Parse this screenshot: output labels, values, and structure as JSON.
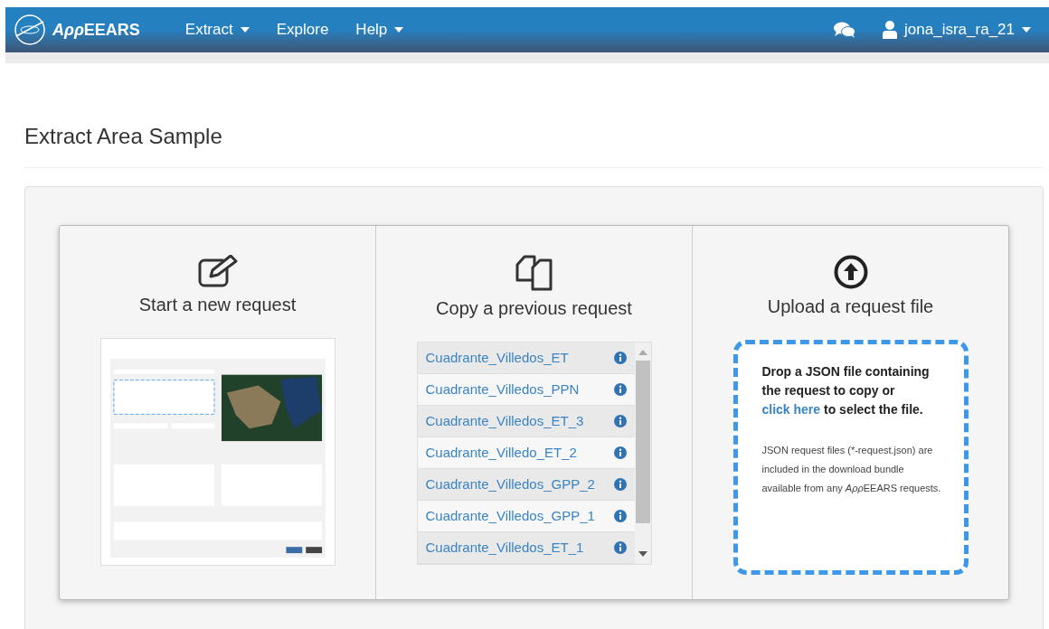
{
  "navbar": {
    "brand": [
      {
        "text": "Aρρ",
        "italic": true
      },
      {
        "text": "EEARS",
        "italic": false
      }
    ],
    "menu": [
      {
        "label": "Extract",
        "dropdown": true
      },
      {
        "label": "Explore",
        "dropdown": false
      },
      {
        "label": "Help",
        "dropdown": true
      }
    ],
    "user": "jona_isra_ra_21"
  },
  "page_title": "Extract Area Sample",
  "options": [
    {
      "kind": "new",
      "title": "Start a new request"
    },
    {
      "kind": "copy",
      "title": "Copy a previous request",
      "requests": [
        {
          "name": "Cuadrante_Villedos_ET"
        },
        {
          "name": "Cuadrante_Villedos_PPN"
        },
        {
          "name": "Cuadrante_Villedos_ET_3"
        },
        {
          "name": "Cuadrante_Villedo_ET_2"
        },
        {
          "name": "Cuadrante_Villedos_GPP_2"
        },
        {
          "name": "Cuadrante_Villedos_GPP_1"
        },
        {
          "name": "Cuadrante_Villedos_ET_1"
        }
      ]
    },
    {
      "kind": "upload",
      "title": "Upload a request file",
      "drop_text_before": "Drop a JSON file containing the request to copy or",
      "drop_link": "click here",
      "drop_text_after": "to select the file.",
      "note": [
        {
          "text": "JSON request files (*-request.json) are included in the download bundle available from any ",
          "italic": false
        },
        {
          "text": "Aρρ",
          "italic": true
        },
        {
          "text": "EEARS requests.",
          "italic": false
        }
      ]
    }
  ]
}
